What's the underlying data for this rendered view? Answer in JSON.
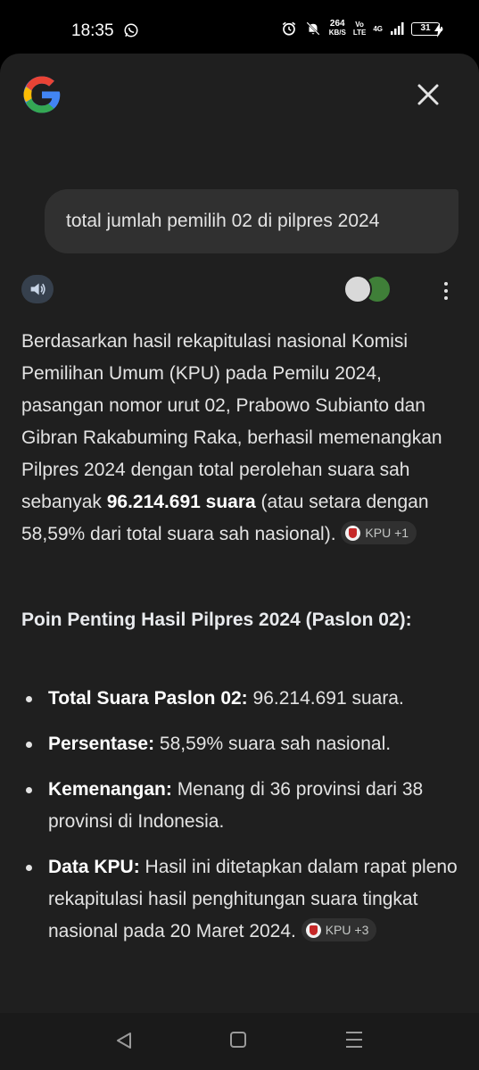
{
  "status_bar": {
    "time": "18:35",
    "net_speed_value": "264",
    "net_speed_unit": "KB/S",
    "volte_top": "Vo",
    "volte_bottom": "LTE",
    "network": "4G",
    "battery": "31",
    "icons": [
      "whatsapp-icon",
      "alarm-icon",
      "mute-icon",
      "signal-icon",
      "battery-icon",
      "charging-icon"
    ]
  },
  "header": {
    "logo": "google-g-logo",
    "close_icon": "close-icon"
  },
  "query": {
    "text": "total jumlah pemilih 02 di pilpres 2024"
  },
  "answer": {
    "p1": "Berdasarkan hasil rekapitulasi nasional Komisi Pemilihan Umum (KPU) pada Pemilu 2024, pasangan nomor urut 02, Prabowo Subianto dan Gibran Rakabuming Raka, berhasil memenangkan Pilpres 2024 dengan total perolehan suara sah sebanyak ",
    "p1_bold": "96.214.691 suara",
    "p1_end": " (atau setara dengan 58,59% dari total suara sah nasional).",
    "p1_chip": "KPU +1"
  },
  "section": {
    "title": "Poin Penting Hasil Pilpres 2024 (Paslon 02):"
  },
  "bullets": [
    {
      "label": "Total Suara Paslon 02:",
      "text": " 96.214.691 suara."
    },
    {
      "label": "Persentase:",
      "text": " 58,59% suara sah nasional."
    },
    {
      "label": "Kemenangan:",
      "text": " Menang di 36 provinsi dari 38 provinsi di Indonesia."
    },
    {
      "label": "Data KPU:",
      "text": " Hasil ini ditetapkan dalam rapat pleno rekapitulasi hasil penghitungan suara tingkat nasional pada 20 Maret 2024.",
      "chip": "KPU +3"
    }
  ],
  "colors": {
    "panel_bg": "#1f1f1f",
    "bubble_bg": "#303030",
    "text": "#e3e3e3",
    "speaker_bg": "#36404d"
  }
}
